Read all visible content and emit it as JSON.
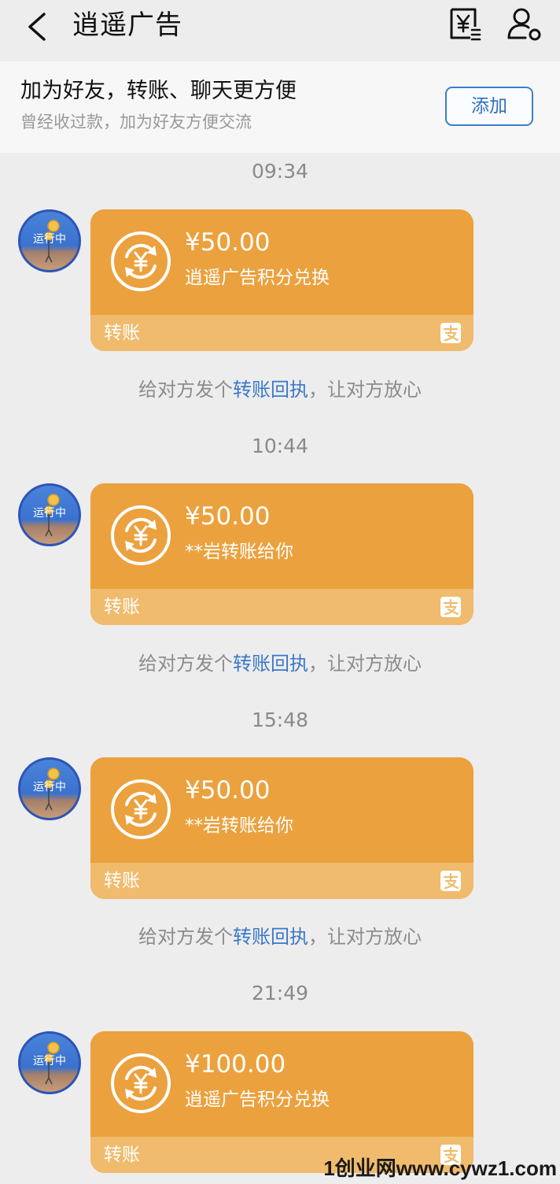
{
  "header": {
    "title": "逍遥广告",
    "back_icon": "chevron-left-icon",
    "bill_icon": "yuan-bill-icon",
    "profile_icon": "person-settings-icon"
  },
  "banner": {
    "title": "加为好友，转账、聊天更方便",
    "subtitle": "曾经收过款，加为好友方便交流",
    "add_button": "添加"
  },
  "avatar_text": "运行中",
  "messages": [
    {
      "time": "09:34",
      "amount": "¥50.00",
      "description": "逍遥广告积分兑换",
      "label": "转账"
    },
    {
      "time": "10:44",
      "amount": "¥50.00",
      "description": "**岩转账给你",
      "label": "转账"
    },
    {
      "time": "15:48",
      "amount": "¥50.00",
      "description": "**岩转账给你",
      "label": "转账"
    },
    {
      "time": "21:49",
      "amount": "¥100.00",
      "description": "逍遥广告积分兑换",
      "label": "转账"
    }
  ],
  "receipt": {
    "prefix": "给对方发个",
    "link": "转账回执",
    "suffix": "，让对方放心"
  },
  "watermark": "1创业网www.cywz1.com",
  "colors": {
    "card": "#eba13e",
    "card_footer": "#f0bb6c",
    "link": "#3b78c9",
    "background": "#ededed"
  }
}
